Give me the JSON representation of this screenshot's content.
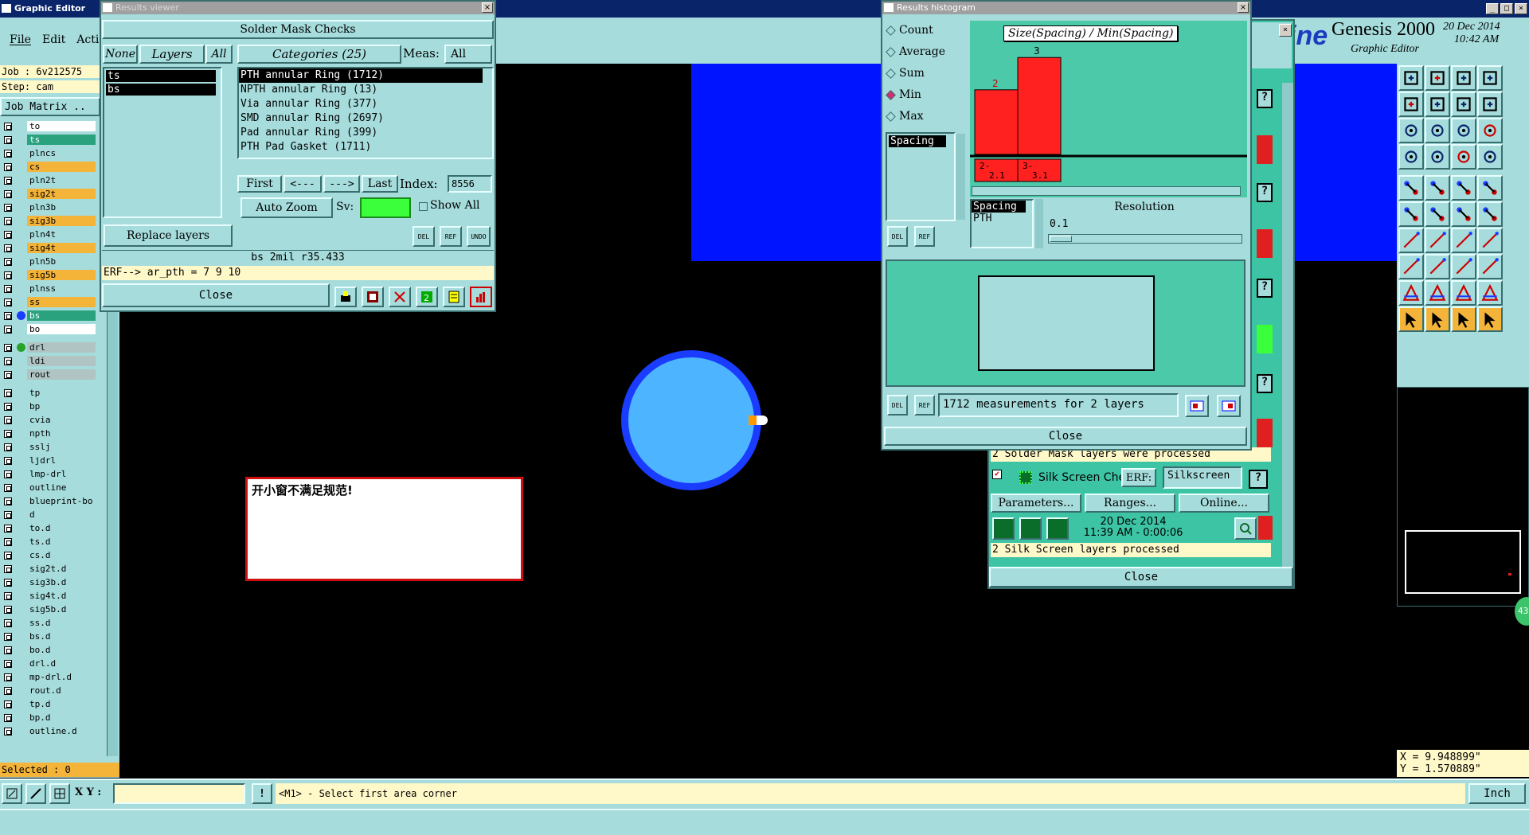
{
  "app": {
    "title": "Graphic Editor",
    "brand_fragment": "ine",
    "brand": "Genesis 2000",
    "subtitle": "Graphic Editor",
    "date": "20 Dec 2014",
    "time": "10:42 AM"
  },
  "menu": [
    "File",
    "Edit",
    "Acti"
  ],
  "job": {
    "job_label": "Job : 6v212575",
    "step_label": "Step: cam",
    "matrix_button": "Job Matrix .."
  },
  "layers": [
    {
      "name": "to",
      "style": "white",
      "tag": "◢"
    },
    {
      "name": "ts",
      "style": "teal2",
      "tag": "◢"
    },
    {
      "name": "plncs",
      "style": "teal",
      "tag": ""
    },
    {
      "name": "cs",
      "style": "orange",
      "tag": "◢"
    },
    {
      "name": "pln2t",
      "style": "teal",
      "tag": ""
    },
    {
      "name": "sig2t",
      "style": "orange",
      "tag": "◢"
    },
    {
      "name": "pln3b",
      "style": "teal",
      "tag": ""
    },
    {
      "name": "sig3b",
      "style": "orange",
      "tag": "◢"
    },
    {
      "name": "pln4t",
      "style": "teal",
      "tag": ""
    },
    {
      "name": "sig4t",
      "style": "orange",
      "tag": "◢"
    },
    {
      "name": "pln5b",
      "style": "teal",
      "tag": ""
    },
    {
      "name": "sig5b",
      "style": "orange",
      "tag": "◢"
    },
    {
      "name": "plnss",
      "style": "teal",
      "tag": ""
    },
    {
      "name": "ss",
      "style": "orange",
      "tag": "◢"
    },
    {
      "name": "bs",
      "style": "teal2",
      "tag": "◢"
    },
    {
      "name": "bo",
      "style": "white",
      "tag": "◢"
    },
    {
      "name": "drl",
      "style": "gray",
      "tag": "■"
    },
    {
      "name": "ldi",
      "style": "gray",
      "tag": ""
    },
    {
      "name": "rout",
      "style": "gray",
      "tag": ""
    },
    {
      "name": "tp",
      "style": "teal",
      "tag": ""
    },
    {
      "name": "bp",
      "style": "teal",
      "tag": ""
    },
    {
      "name": "cvia",
      "style": "teal",
      "tag": ""
    },
    {
      "name": "npth",
      "style": "teal",
      "tag": ""
    },
    {
      "name": "sslj",
      "style": "teal",
      "tag": ""
    },
    {
      "name": "ljdrl",
      "style": "teal",
      "tag": ""
    },
    {
      "name": "lmp-drl",
      "style": "teal",
      "tag": ""
    },
    {
      "name": "outline",
      "style": "teal",
      "tag": ""
    },
    {
      "name": "blueprint-bo",
      "style": "teal",
      "tag": ""
    },
    {
      "name": "d",
      "style": "teal",
      "tag": ""
    },
    {
      "name": "to.d",
      "style": "teal",
      "tag": "◢"
    },
    {
      "name": "ts.d",
      "style": "teal",
      "tag": "◢"
    },
    {
      "name": "cs.d",
      "style": "teal",
      "tag": "◢"
    },
    {
      "name": "sig2t.d",
      "style": "teal",
      "tag": "◢"
    },
    {
      "name": "sig3b.d",
      "style": "teal",
      "tag": "◢"
    },
    {
      "name": "sig4t.d",
      "style": "teal",
      "tag": "◢"
    },
    {
      "name": "sig5b.d",
      "style": "teal",
      "tag": "◢"
    },
    {
      "name": "ss.d",
      "style": "teal",
      "tag": "◢"
    },
    {
      "name": "bs.d",
      "style": "teal",
      "tag": "◢"
    },
    {
      "name": "bo.d",
      "style": "teal",
      "tag": "◢"
    },
    {
      "name": "drl.d",
      "style": "teal",
      "tag": ""
    },
    {
      "name": "mp-drl.d",
      "style": "teal",
      "tag": ""
    },
    {
      "name": "rout.d",
      "style": "teal",
      "tag": ""
    },
    {
      "name": "tp.d",
      "style": "teal",
      "tag": ""
    },
    {
      "name": "bp.d",
      "style": "teal",
      "tag": ""
    },
    {
      "name": "outline.d",
      "style": "teal",
      "tag": ""
    }
  ],
  "selected_label": "Selected : 0",
  "results_viewer": {
    "title": "Results viewer",
    "heading": "Solder Mask Checks",
    "none_btn": "None",
    "layers_btn": "Layers",
    "all_btn": "All",
    "layer_items": [
      "ts",
      "bs"
    ],
    "categories_btn": "Categories (25)",
    "meas_label": "Meas:",
    "meas_value": "All",
    "categories": [
      "PTH annular Ring (1712)",
      "NPTH annular Ring (13)",
      "Via annular Ring (377)",
      "SMD annular Ring (2697)",
      "Pad annular Ring (399)",
      "PTH Pad Gasket (1711)"
    ],
    "first_btn": "First",
    "prev_btn": "<---",
    "next_btn": "--->",
    "last_btn": "Last",
    "index_label": "Index:",
    "index_value": "8556",
    "auto_zoom": "Auto Zoom",
    "sv_label": "Sv:",
    "show_all": "Show All",
    "replace_layers": "Replace layers",
    "del": "DEL",
    "ref": "REF",
    "undo": "UNDO",
    "status": "bs 2mil  r35.433",
    "erf_line": "ERF--> ar_pth = 7 9 10",
    "close": "Close"
  },
  "histogram": {
    "title": "Results histogram",
    "options": [
      "Count",
      "Average",
      "Sum",
      "Min",
      "Max"
    ],
    "selected_option": "Min",
    "list_item": "Spacing",
    "chart_title": "Size(Spacing) / Min(Spacing)",
    "del": "DEL",
    "ref": "REF",
    "spacing_label": "Spacing",
    "spacing_value": "PTH",
    "resolution_label": "Resolution",
    "resolution_value": "0.1",
    "summary": "1712 measurements for 2 layers",
    "close": "Close"
  },
  "chart_data": {
    "type": "bar",
    "title": "Size(Spacing) / Min(Spacing)",
    "categories": [
      "2-2.1",
      "3-3.1"
    ],
    "bar_labels": [
      "2",
      "3"
    ],
    "category_labels": [
      "2-\n 2.1",
      "3-\n 3.1"
    ],
    "values": [
      2,
      3
    ],
    "colors": [
      "#ff2020",
      "#ff2020"
    ],
    "ylim": [
      0,
      3.4
    ]
  },
  "checklist": {
    "solder_result": "2 Solder Mask layers were processed",
    "silk_name": "Silk Screen Che",
    "erf_label": "ERF:",
    "erf_value": "Silkscreen",
    "parameters": "Parameters...",
    "ranges": "Ranges...",
    "online": "Online...",
    "date": "20 Dec 2014",
    "time": "11:39 AM - 0:00:06",
    "silk_result": "2 Silk Screen layers processed",
    "close": "Close",
    "help": "?"
  },
  "canvas": {
    "note_text": "开小窗不满足规范!",
    "colors": {
      "pad_fill": "#4db4ff",
      "pad_ring": "#1a3cff",
      "blue_region": "#0014ff",
      "background": "#000000"
    }
  },
  "coords": {
    "x": "X = 9.948899\"",
    "y": "Y = 1.570889\""
  },
  "badge": "43",
  "bottom": {
    "xy_label": "X Y :",
    "xy_input": "",
    "prompt": "<M1> - Select first area corner",
    "units": "Inch"
  }
}
